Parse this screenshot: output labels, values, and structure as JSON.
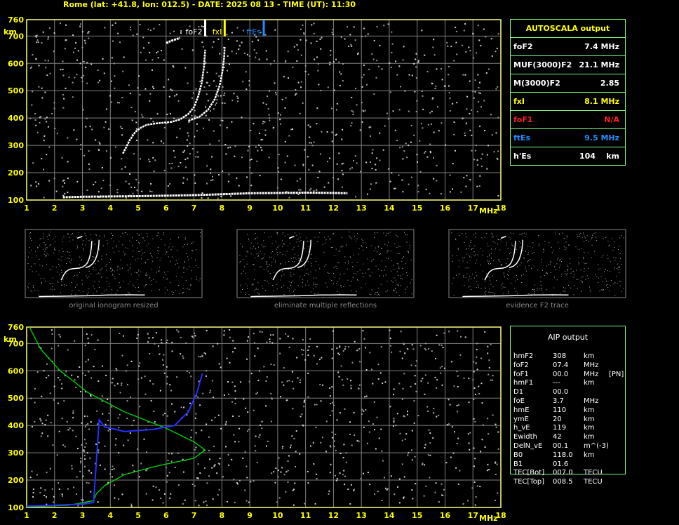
{
  "header": {
    "title": "Rome (lat: +41.8, lon: 012.5) - DATE: 2025 08 13 - TIME (UT): 11:30"
  },
  "colors": {
    "grid": "#7f7f7f",
    "frame": "#ffff7f",
    "trace": "#ffffff",
    "foF2": "#ffffff",
    "fxI": "#ffff00",
    "ftEs": "#1e90ff",
    "foF1": "#ff2020",
    "table_border": "#7fff7f",
    "profile": "#00dd00",
    "fit": "#2233ff"
  },
  "autoscala": {
    "title": "AUTOSCALA output",
    "rows": [
      {
        "label": "foF2",
        "value": "7.4 MHz",
        "color": "#ffffff"
      },
      {
        "label": "MUF(3000)F2",
        "value": "21.1 MHz",
        "color": "#ffffff"
      },
      {
        "label": "M(3000)F2",
        "value": "2.85",
        "color": "#ffffff"
      },
      {
        "label": "fxI",
        "value": "8.1 MHz",
        "color": "#ffff00"
      },
      {
        "label": "foF1",
        "value": "N/A",
        "color": "#ff2020"
      },
      {
        "label": "ftEs",
        "value": "9.5 MHz",
        "color": "#1e90ff"
      },
      {
        "label": "h'Es",
        "value": "104    km",
        "color": "#ffffff"
      }
    ]
  },
  "aip": {
    "title": "AIP output",
    "rows": [
      {
        "name": "hmF2",
        "value": "308",
        "unit": "km",
        "extra": ""
      },
      {
        "name": "foF2",
        "value": "07.4",
        "unit": "MHz",
        "extra": ""
      },
      {
        "name": "foF1",
        "value": "00.0",
        "unit": "MHz",
        "extra": "[PN]"
      },
      {
        "name": "hmF1",
        "value": "---",
        "unit": "km",
        "extra": ""
      },
      {
        "name": "D1",
        "value": "00.0",
        "unit": "",
        "extra": ""
      },
      {
        "name": "foE",
        "value": "3.7",
        "unit": "MHz",
        "extra": ""
      },
      {
        "name": "hmE",
        "value": "110",
        "unit": "km",
        "extra": ""
      },
      {
        "name": "ymE",
        "value": "20",
        "unit": "km",
        "extra": ""
      },
      {
        "name": "h_vE",
        "value": "119",
        "unit": "km",
        "extra": ""
      },
      {
        "name": "Ewidth",
        "value": "42",
        "unit": "km",
        "extra": ""
      },
      {
        "name": "DelN_vE",
        "value": "00.1",
        "unit": "m^(-3)",
        "extra": ""
      },
      {
        "name": "B0",
        "value": "118.0",
        "unit": "km",
        "extra": ""
      },
      {
        "name": "B1",
        "value": "01.6",
        "unit": "",
        "extra": ""
      },
      {
        "name": "TEC[Bot]",
        "value": "007.0",
        "unit": "TECU",
        "extra": ""
      },
      {
        "name": "TEC[Top]",
        "value": "008.5",
        "unit": "TECU",
        "extra": ""
      }
    ]
  },
  "thumbnails": [
    {
      "caption": "original ionogram resized"
    },
    {
      "caption": "eliminate multiple reflections"
    },
    {
      "caption": "evidence F2 trace"
    }
  ],
  "chart_data": [
    {
      "type": "scatter",
      "title": "",
      "xlabel": "MHz",
      "ylabel": "km",
      "xlim": [
        1,
        18
      ],
      "ylim": [
        100,
        760
      ],
      "x_ticks": [
        1,
        2,
        3,
        4,
        5,
        6,
        7,
        8,
        9,
        10,
        11,
        12,
        13,
        14,
        15,
        16,
        17,
        18
      ],
      "y_ticks": [
        100,
        200,
        300,
        400,
        500,
        600,
        700,
        760
      ],
      "grid": true,
      "markers": [
        {
          "name": "foF2",
          "x": 7.4,
          "label": "foF2"
        },
        {
          "name": "fxI",
          "x": 8.1,
          "label": "fxI"
        },
        {
          "name": "ftEs",
          "x": 9.5,
          "label": "ftEs"
        }
      ],
      "series": [
        {
          "role": "o-trace",
          "points": [
            [
              4.45,
              270
            ],
            [
              4.55,
              290
            ],
            [
              4.7,
              320
            ],
            [
              4.9,
              350
            ],
            [
              5.1,
              365
            ],
            [
              5.3,
              375
            ],
            [
              5.6,
              380
            ],
            [
              5.9,
              383
            ],
            [
              6.2,
              386
            ],
            [
              6.5,
              395
            ],
            [
              6.8,
              415
            ],
            [
              7.0,
              440
            ],
            [
              7.15,
              480
            ],
            [
              7.28,
              530
            ],
            [
              7.36,
              590
            ],
            [
              7.4,
              650
            ]
          ]
        },
        {
          "role": "x-trace",
          "points": [
            [
              6.8,
              390
            ],
            [
              7.2,
              405
            ],
            [
              7.5,
              430
            ],
            [
              7.75,
              470
            ],
            [
              7.92,
              520
            ],
            [
              8.02,
              570
            ],
            [
              8.08,
              620
            ],
            [
              8.1,
              660
            ]
          ]
        },
        {
          "role": "Es-trace",
          "points": [
            [
              2.3,
              110
            ],
            [
              3.0,
              112
            ],
            [
              4.0,
              113
            ],
            [
              5.0,
              114
            ],
            [
              6.0,
              116
            ],
            [
              7.0,
              118
            ],
            [
              8.0,
              121
            ],
            [
              9.0,
              125
            ],
            [
              10.0,
              126
            ],
            [
              11.0,
              127
            ],
            [
              12.0,
              126
            ],
            [
              12.5,
              125
            ]
          ]
        },
        {
          "role": "Es-trace",
          "points": [
            [
              6.0,
              675
            ],
            [
              6.25,
              685
            ],
            [
              6.5,
              693
            ]
          ]
        }
      ]
    },
    {
      "type": "line",
      "title": "",
      "xlabel": "MHz",
      "ylabel": "km",
      "xlim": [
        1,
        18
      ],
      "ylim": [
        100,
        760
      ],
      "x_ticks": [
        1,
        2,
        3,
        4,
        5,
        6,
        7,
        8,
        9,
        10,
        11,
        12,
        13,
        14,
        15,
        16,
        17,
        18
      ],
      "y_ticks": [
        100,
        200,
        300,
        400,
        500,
        600,
        700,
        760
      ],
      "grid": true,
      "series": [
        {
          "role": "electron-density-profile",
          "points": [
            [
              1.1,
              760
            ],
            [
              1.5,
              680
            ],
            [
              2.2,
              600
            ],
            [
              3.2,
              520
            ],
            [
              4.5,
              450
            ],
            [
              6.0,
              390
            ],
            [
              7.0,
              340
            ],
            [
              7.4,
              310
            ],
            [
              7.0,
              280
            ],
            [
              5.6,
              250
            ],
            [
              4.5,
              220
            ],
            [
              3.8,
              180
            ],
            [
              3.5,
              150
            ],
            [
              3.4,
              125
            ],
            [
              2.5,
              108
            ],
            [
              1.0,
              102
            ]
          ]
        },
        {
          "role": "virtual-height-fit",
          "points": [
            [
              1.0,
              105
            ],
            [
              2.0,
              108
            ],
            [
              3.0,
              112
            ],
            [
              3.4,
              118
            ],
            [
              3.6,
              420
            ],
            [
              3.8,
              395
            ],
            [
              4.5,
              378
            ],
            [
              5.5,
              385
            ],
            [
              6.3,
              400
            ],
            [
              6.8,
              450
            ],
            [
              7.1,
              520
            ],
            [
              7.3,
              590
            ]
          ]
        }
      ]
    }
  ]
}
